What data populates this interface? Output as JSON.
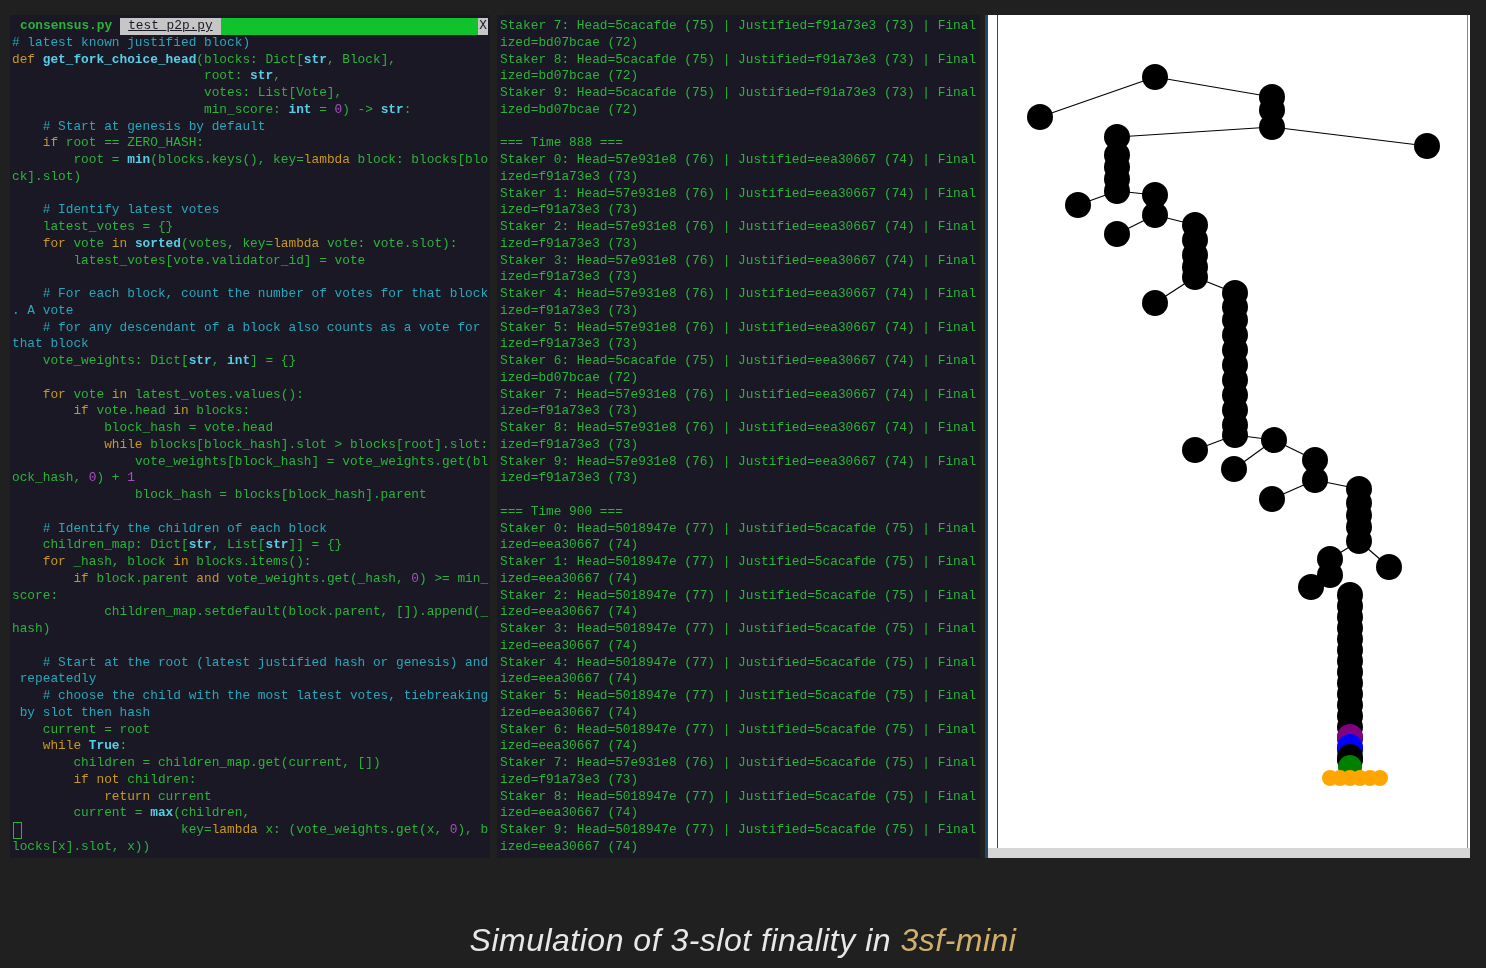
{
  "editor": {
    "tabs": [
      {
        "label": "consensus.py",
        "selected": true
      },
      {
        "label": "test_p2p.py",
        "selected": false
      }
    ],
    "close": "X",
    "lines": [
      {
        "segs": [
          {
            "text": "# latest known justified block)",
            "kind": "comment"
          }
        ]
      },
      {
        "segs": [
          {
            "text": "def ",
            "kind": "keyword"
          },
          {
            "text": "get_fork_choice_head",
            "kind": "builtin"
          },
          {
            "text": "(blocks: Dict[",
            "kind": "name"
          },
          {
            "text": "str",
            "kind": "builtin"
          },
          {
            "text": ", Block],",
            "kind": "name"
          }
        ]
      },
      {
        "segs": [
          {
            "text": "                         root: ",
            "kind": "name"
          },
          {
            "text": "str",
            "kind": "builtin"
          },
          {
            "text": ",",
            "kind": "name"
          }
        ]
      },
      {
        "segs": [
          {
            "text": "                         votes: List[Vote],",
            "kind": "name"
          }
        ]
      },
      {
        "segs": [
          {
            "text": "                         min_score: ",
            "kind": "name"
          },
          {
            "text": "int",
            "kind": "builtin"
          },
          {
            "text": " = ",
            "kind": "name"
          },
          {
            "text": "0",
            "kind": "number"
          },
          {
            "text": ") -> ",
            "kind": "name"
          },
          {
            "text": "str",
            "kind": "builtin"
          },
          {
            "text": ":",
            "kind": "name"
          }
        ]
      },
      {
        "segs": [
          {
            "text": "    # Start at genesis by default",
            "kind": "comment"
          }
        ]
      },
      {
        "segs": [
          {
            "text": "    if ",
            "kind": "keyword"
          },
          {
            "text": "root == ZERO_HASH:",
            "kind": "name"
          }
        ]
      },
      {
        "segs": [
          {
            "text": "        root = ",
            "kind": "name"
          },
          {
            "text": "min",
            "kind": "builtin"
          },
          {
            "text": "(blocks.keys(), key=",
            "kind": "name"
          },
          {
            "text": "lambda",
            "kind": "keyword"
          },
          {
            "text": " block: blocks[blo",
            "kind": "name"
          }
        ]
      },
      {
        "segs": [
          {
            "text": "ck].slot)",
            "kind": "name"
          }
        ]
      },
      {
        "gap_before": true,
        "segs": [
          {
            "text": "    # Identify latest votes",
            "kind": "comment"
          }
        ]
      },
      {
        "segs": [
          {
            "text": "    latest_votes = {}",
            "kind": "name"
          }
        ]
      },
      {
        "segs": [
          {
            "text": "    for ",
            "kind": "keyword"
          },
          {
            "text": "vote ",
            "kind": "name"
          },
          {
            "text": "in ",
            "kind": "keyword"
          },
          {
            "text": "sorted",
            "kind": "builtin"
          },
          {
            "text": "(votes, key=",
            "kind": "name"
          },
          {
            "text": "lambda",
            "kind": "keyword"
          },
          {
            "text": " vote: vote.slot):",
            "kind": "name"
          }
        ]
      },
      {
        "segs": [
          {
            "text": "        latest_votes[vote.validator_id] = vote",
            "kind": "name"
          }
        ]
      },
      {
        "gap_before": true,
        "segs": [
          {
            "text": "    # For each block, count the number of votes for that block",
            "kind": "comment"
          }
        ]
      },
      {
        "segs": [
          {
            "text": ". A vote",
            "kind": "comment"
          }
        ]
      },
      {
        "segs": [
          {
            "text": "    # for any descendant of a block also counts as a vote for",
            "kind": "comment"
          }
        ]
      },
      {
        "segs": [
          {
            "text": "that block",
            "kind": "comment"
          }
        ]
      },
      {
        "segs": [
          {
            "text": "    vote_weights: Dict[",
            "kind": "name"
          },
          {
            "text": "str",
            "kind": "builtin"
          },
          {
            "text": ", ",
            "kind": "name"
          },
          {
            "text": "int",
            "kind": "builtin"
          },
          {
            "text": "] = {}",
            "kind": "name"
          }
        ]
      },
      {
        "gap_before": true,
        "segs": [
          {
            "text": "    for ",
            "kind": "keyword"
          },
          {
            "text": "vote ",
            "kind": "name"
          },
          {
            "text": "in ",
            "kind": "keyword"
          },
          {
            "text": "latest_votes.values():",
            "kind": "name"
          }
        ]
      },
      {
        "segs": [
          {
            "text": "        if ",
            "kind": "keyword"
          },
          {
            "text": "vote.head ",
            "kind": "name"
          },
          {
            "text": "in ",
            "kind": "keyword"
          },
          {
            "text": "blocks:",
            "kind": "name"
          }
        ]
      },
      {
        "segs": [
          {
            "text": "            block_hash = vote.head",
            "kind": "name"
          }
        ]
      },
      {
        "segs": [
          {
            "text": "            while ",
            "kind": "keyword"
          },
          {
            "text": "blocks[block_hash].slot > blocks[root].slot:",
            "kind": "name"
          }
        ]
      },
      {
        "segs": [
          {
            "text": "                vote_weights[block_hash] = vote_weights.get(bl",
            "kind": "name"
          }
        ]
      },
      {
        "segs": [
          {
            "text": "ock_hash, ",
            "kind": "name"
          },
          {
            "text": "0",
            "kind": "number"
          },
          {
            "text": ") + ",
            "kind": "name"
          },
          {
            "text": "1",
            "kind": "number"
          }
        ]
      },
      {
        "segs": [
          {
            "text": "                block_hash = blocks[block_hash].parent",
            "kind": "name"
          }
        ]
      },
      {
        "gap_before": true,
        "segs": [
          {
            "text": "    # Identify the children of each block",
            "kind": "comment"
          }
        ]
      },
      {
        "segs": [
          {
            "text": "    children_map: Dict[",
            "kind": "name"
          },
          {
            "text": "str",
            "kind": "builtin"
          },
          {
            "text": ", List[",
            "kind": "name"
          },
          {
            "text": "str",
            "kind": "builtin"
          },
          {
            "text": "]] = {}",
            "kind": "name"
          }
        ]
      },
      {
        "segs": [
          {
            "text": "    for ",
            "kind": "keyword"
          },
          {
            "text": "_hash, block ",
            "kind": "name"
          },
          {
            "text": "in ",
            "kind": "keyword"
          },
          {
            "text": "blocks.items():",
            "kind": "name"
          }
        ]
      },
      {
        "segs": [
          {
            "text": "        if ",
            "kind": "keyword"
          },
          {
            "text": "block.parent ",
            "kind": "name"
          },
          {
            "text": "and ",
            "kind": "keyword"
          },
          {
            "text": "vote_weights.get(_hash, ",
            "kind": "name"
          },
          {
            "text": "0",
            "kind": "number"
          },
          {
            "text": ") >= min_",
            "kind": "name"
          }
        ]
      },
      {
        "segs": [
          {
            "text": "score:",
            "kind": "name"
          }
        ]
      },
      {
        "segs": [
          {
            "text": "            children_map.setdefault(block.parent, []).append(_",
            "kind": "name"
          }
        ]
      },
      {
        "segs": [
          {
            "text": "hash)",
            "kind": "name"
          }
        ]
      },
      {
        "gap_before": true,
        "segs": [
          {
            "text": "    # Start at the root (latest justified hash or genesis) and",
            "kind": "comment"
          }
        ]
      },
      {
        "segs": [
          {
            "text": " repeatedly",
            "kind": "comment"
          }
        ]
      },
      {
        "segs": [
          {
            "text": "    # choose the child with the most latest votes, tiebreaking",
            "kind": "comment"
          }
        ]
      },
      {
        "segs": [
          {
            "text": " by slot then hash",
            "kind": "comment"
          }
        ]
      },
      {
        "segs": [
          {
            "text": "    current = root",
            "kind": "name"
          }
        ]
      },
      {
        "segs": [
          {
            "text": "    while ",
            "kind": "keyword"
          },
          {
            "text": "True",
            "kind": "builtin"
          },
          {
            "text": ":",
            "kind": "name"
          }
        ]
      },
      {
        "segs": [
          {
            "text": "        children = children_map.get(current, [])",
            "kind": "name"
          }
        ]
      },
      {
        "segs": [
          {
            "text": "        if not ",
            "kind": "keyword"
          },
          {
            "text": "children:",
            "kind": "name"
          }
        ]
      },
      {
        "segs": [
          {
            "text": "            return ",
            "kind": "keyword"
          },
          {
            "text": "current",
            "kind": "name"
          }
        ]
      },
      {
        "segs": [
          {
            "text": "        current = ",
            "kind": "name"
          },
          {
            "text": "max",
            "kind": "builtin"
          },
          {
            "text": "(children,",
            "kind": "name"
          }
        ]
      },
      {
        "cursor": true,
        "segs": [
          {
            "text": "                      key=",
            "kind": "name"
          },
          {
            "text": "lambda",
            "kind": "keyword"
          },
          {
            "text": " x: (vote_weights.get(x, ",
            "kind": "name"
          },
          {
            "text": "0",
            "kind": "number"
          },
          {
            "text": "), b",
            "kind": "name"
          }
        ]
      },
      {
        "segs": [
          {
            "text": "locks[x].slot, x))",
            "kind": "name"
          }
        ]
      }
    ]
  },
  "terminal": {
    "lines": [
      {
        "text": "Staker 7: Head=5cacafde (75) | Justified=f91a73e3 (73) | Final"
      },
      {
        "text": "ized=bd07bcae (72)"
      },
      {
        "text": "Staker 8: Head=5cacafde (75) | Justified=f91a73e3 (73) | Final"
      },
      {
        "text": "ized=bd07bcae (72)"
      },
      {
        "text": "Staker 9: Head=5cacafde (75) | Justified=f91a73e3 (73) | Final"
      },
      {
        "text": "ized=bd07bcae (72)"
      },
      {
        "text": "=== Time 888 ===",
        "gap_before": true
      },
      {
        "text": "Staker 0: Head=57e931e8 (76) | Justified=eea30667 (74) | Final"
      },
      {
        "text": "ized=f91a73e3 (73)"
      },
      {
        "text": "Staker 1: Head=57e931e8 (76) | Justified=eea30667 (74) | Final"
      },
      {
        "text": "ized=f91a73e3 (73)"
      },
      {
        "text": "Staker 2: Head=57e931e8 (76) | Justified=eea30667 (74) | Final"
      },
      {
        "text": "ized=f91a73e3 (73)"
      },
      {
        "text": "Staker 3: Head=57e931e8 (76) | Justified=eea30667 (74) | Final"
      },
      {
        "text": "ized=f91a73e3 (73)"
      },
      {
        "text": "Staker 4: Head=57e931e8 (76) | Justified=eea30667 (74) | Final"
      },
      {
        "text": "ized=f91a73e3 (73)"
      },
      {
        "text": "Staker 5: Head=57e931e8 (76) | Justified=eea30667 (74) | Final"
      },
      {
        "text": "ized=f91a73e3 (73)"
      },
      {
        "text": "Staker 6: Head=5cacafde (75) | Justified=eea30667 (74) | Final"
      },
      {
        "text": "ized=bd07bcae (72)"
      },
      {
        "text": "Staker 7: Head=57e931e8 (76) | Justified=eea30667 (74) | Final"
      },
      {
        "text": "ized=f91a73e3 (73)"
      },
      {
        "text": "Staker 8: Head=57e931e8 (76) | Justified=eea30667 (74) | Final"
      },
      {
        "text": "ized=f91a73e3 (73)"
      },
      {
        "text": "Staker 9: Head=57e931e8 (76) | Justified=eea30667 (74) | Final"
      },
      {
        "text": "ized=f91a73e3 (73)"
      },
      {
        "text": "=== Time 900 ===",
        "gap_before": true
      },
      {
        "text": "Staker 0: Head=5018947e (77) | Justified=5cacafde (75) | Final"
      },
      {
        "text": "ized=eea30667 (74)"
      },
      {
        "text": "Staker 1: Head=5018947e (77) | Justified=5cacafde (75) | Final"
      },
      {
        "text": "ized=eea30667 (74)"
      },
      {
        "text": "Staker 2: Head=5018947e (77) | Justified=5cacafde (75) | Final"
      },
      {
        "text": "ized=eea30667 (74)"
      },
      {
        "text": "Staker 3: Head=5018947e (77) | Justified=5cacafde (75) | Final"
      },
      {
        "text": "ized=eea30667 (74)"
      },
      {
        "text": "Staker 4: Head=5018947e (77) | Justified=5cacafde (75) | Final"
      },
      {
        "text": "ized=eea30667 (74)"
      },
      {
        "text": "Staker 5: Head=5018947e (77) | Justified=5cacafde (75) | Final"
      },
      {
        "text": "ized=eea30667 (74)"
      },
      {
        "text": "Staker 6: Head=5018947e (77) | Justified=5cacafde (75) | Final"
      },
      {
        "text": "ized=eea30667 (74)"
      },
      {
        "text": "Staker 7: Head=57e931e8 (76) | Justified=5cacafde (75) | Final"
      },
      {
        "text": "ized=f91a73e3 (73)"
      },
      {
        "text": "Staker 8: Head=5018947e (77) | Justified=5cacafde (75) | Final"
      },
      {
        "text": "ized=eea30667 (74)"
      },
      {
        "text": "Staker 9: Head=5018947e (77) | Justified=5cacafde (75) | Final"
      },
      {
        "text": "ized=eea30667 (74)"
      }
    ]
  },
  "caption": {
    "text": "Simulation of 3-slot finality in ",
    "link": "3sf-mini"
  }
}
